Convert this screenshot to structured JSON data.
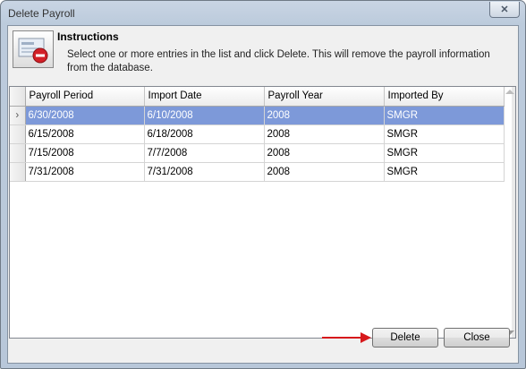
{
  "window": {
    "title": "Delete Payroll",
    "close_glyph": "✕"
  },
  "instructions": {
    "title": "Instructions",
    "text": "Select one or more entries in the list and click Delete. This will remove the payroll information from the database.",
    "icon": "payroll-delete-icon"
  },
  "grid": {
    "columns": [
      "Payroll Period",
      "Import Date",
      "Payroll Year",
      "Imported By"
    ],
    "selected_row_indicator": "›",
    "rows": [
      [
        "6/30/2008",
        "6/10/2008",
        "2008",
        "SMGR"
      ],
      [
        "6/15/2008",
        "6/18/2008",
        "2008",
        "SMGR"
      ],
      [
        "7/15/2008",
        "7/7/2008",
        "2008",
        "SMGR"
      ],
      [
        "7/31/2008",
        "7/31/2008",
        "2008",
        "SMGR"
      ]
    ],
    "selected_index": 0,
    "selection_color": "#7d99d9"
  },
  "buttons": {
    "delete": "Delete",
    "close": "Close"
  },
  "annotation": {
    "arrow_color": "#d7191c"
  }
}
